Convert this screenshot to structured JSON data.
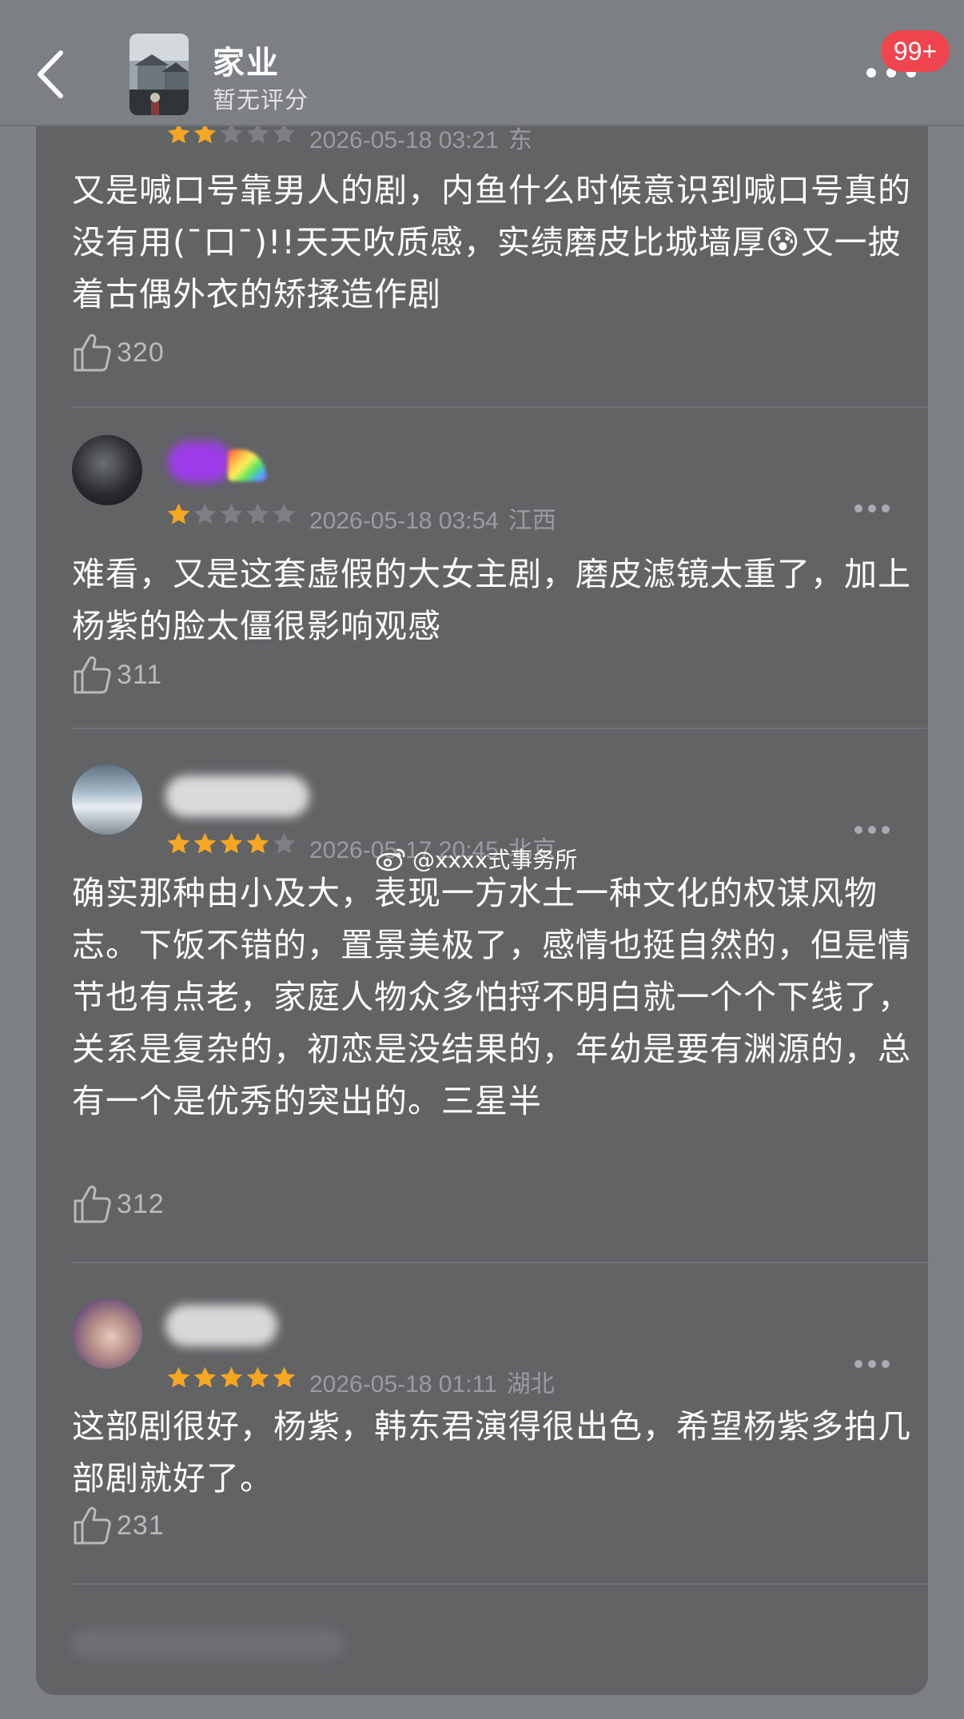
{
  "header": {
    "title": "家业",
    "rating_text": "暂无评分",
    "notification_badge": "99+",
    "back_icon": "chevron-left-icon",
    "more_icon": "more-horizontal-icon"
  },
  "watermark": {
    "text": "@xxxx式事务所",
    "icon": "weibo-icon"
  },
  "colors": {
    "star_filled": "#f5a623",
    "star_empty": "#7d7f82",
    "badge": "#f0454f",
    "card_bg": "#616365"
  },
  "reviews": [
    {
      "stars": 2,
      "date": "2026-05-18 03:21",
      "location": "东",
      "content": "又是喊口号靠男人的剧，内鱼什么时候意识到喊口号真的没有用(ˉ口ˉ)!!天天吹质感，实绩磨皮比城墙厚😰又一披着古偶外衣的矫揉造作剧",
      "likes": "320"
    },
    {
      "stars": 1,
      "date": "2026-05-18 03:54",
      "location": "江西",
      "content": "难看，又是这套虚假的大女主剧，磨皮滤镜太重了，加上杨紫的脸太僵很影响观感",
      "likes": "311"
    },
    {
      "stars": 4,
      "date": "2026-05-17 20:45",
      "location": "北京",
      "content": "确实那种由小及大，表现一方水土一种文化的权谋风物志。下饭不错的，置景美极了，感情也挺自然的，但是情节也有点老，家庭人物众多怕捋不明白就一个个下线了，关系是复杂的，初恋是没结果的，年幼是要有渊源的，总有一个是优秀的突出的。三星半",
      "likes": "312"
    },
    {
      "stars": 5,
      "date": "2026-05-18 01:11",
      "location": "湖北",
      "content": "这部剧很好，杨紫，韩东君演得很出色，希望杨紫多拍几部剧就好了。",
      "likes": "231"
    }
  ]
}
